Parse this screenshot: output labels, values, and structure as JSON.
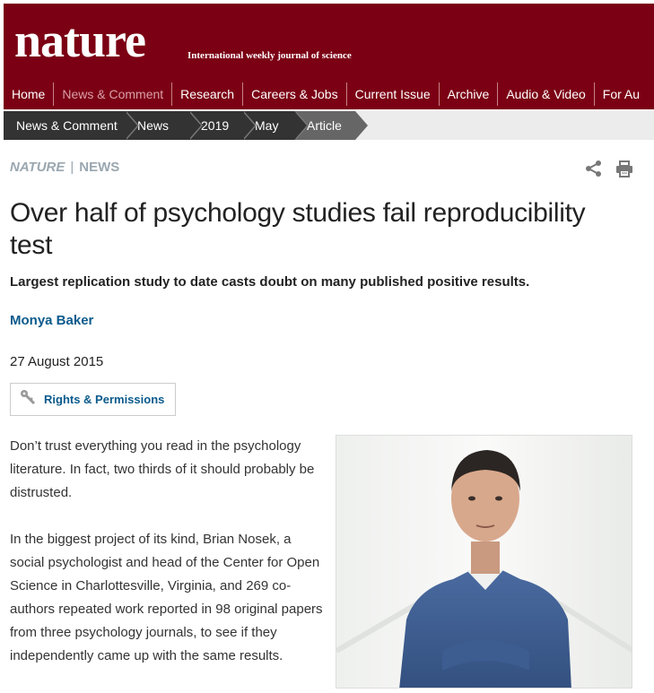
{
  "header": {
    "logo": "nature",
    "tagline": "International weekly journal of science",
    "nav": [
      "Home",
      "News & Comment",
      "Research",
      "Careers & Jobs",
      "Current Issue",
      "Archive",
      "Audio & Video",
      "For Au"
    ]
  },
  "breadcrumb": [
    "News & Comment",
    "News",
    "2019",
    "May",
    "Article"
  ],
  "article": {
    "kicker_brand": "NATURE",
    "kicker_sep": "|",
    "kicker_section": "NEWS",
    "title": "Over half of psychology studies fail reproducibility test",
    "standfirst": "Largest replication study to date casts doubt on many published positive results.",
    "author": "Monya Baker",
    "date": "27 August 2015",
    "rights_label": "Rights & Permissions",
    "paragraphs": [
      "Don’t trust everything you read in the psychology literature. In fact, two thirds of it should probably be distrusted.",
      "In the biggest project of its kind, Brian Nosek, a social psychologist and head of the Center for Open Science in Charlottesville, Virginia, and 269 co-authors repeated work reported in 98 original papers from three psychology journals, to see if they independently came up with the same results."
    ]
  },
  "icons": {
    "share": "share-icon",
    "print": "print-icon",
    "key": "key-icon"
  },
  "colors": {
    "brand": "#7b0014",
    "link": "#0b5a8c",
    "kicker": "#9aa7b0"
  }
}
